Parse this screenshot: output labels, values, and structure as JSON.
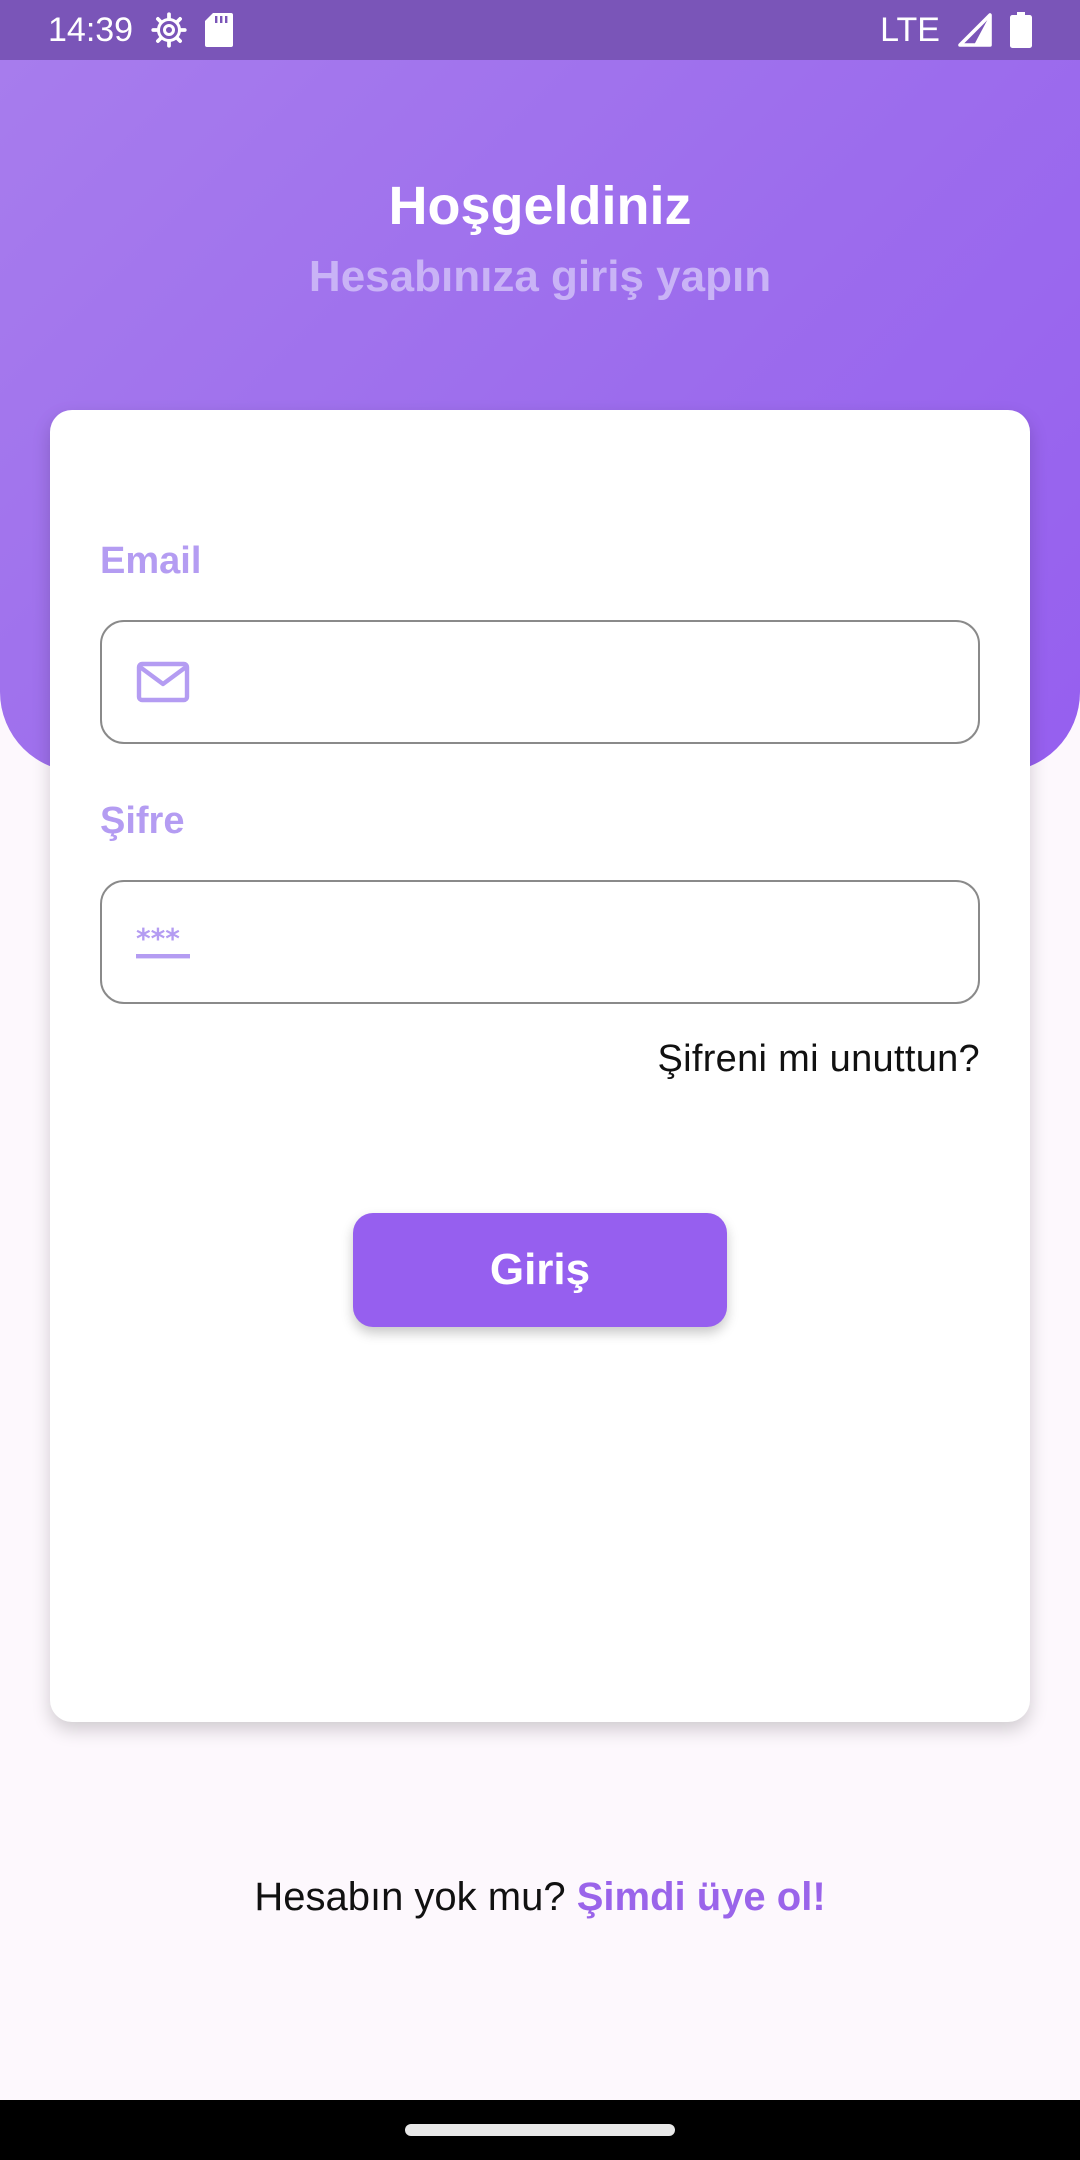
{
  "status_bar": {
    "time": "14:39",
    "network": "LTE",
    "icons": [
      "settings-icon",
      "sd-card-icon",
      "signal-icon",
      "battery-icon"
    ]
  },
  "header": {
    "title": "Hoşgeldiniz",
    "subtitle": "Hesabınıza giriş yapın"
  },
  "form": {
    "email_label": "Email",
    "email_value": "",
    "email_icon": "mail-icon",
    "password_label": "Şifre",
    "password_value": "",
    "password_icon": "password-icon",
    "forgot_label": "Şifreni mi unuttun?",
    "login_label": "Giriş"
  },
  "footer": {
    "prompt": "Hesabın yok mu?",
    "signup_link": "Şimdi üye ol!"
  },
  "colors": {
    "primary": "#965fef",
    "label": "#b49cf2",
    "status_bar": "#7a55b8"
  }
}
